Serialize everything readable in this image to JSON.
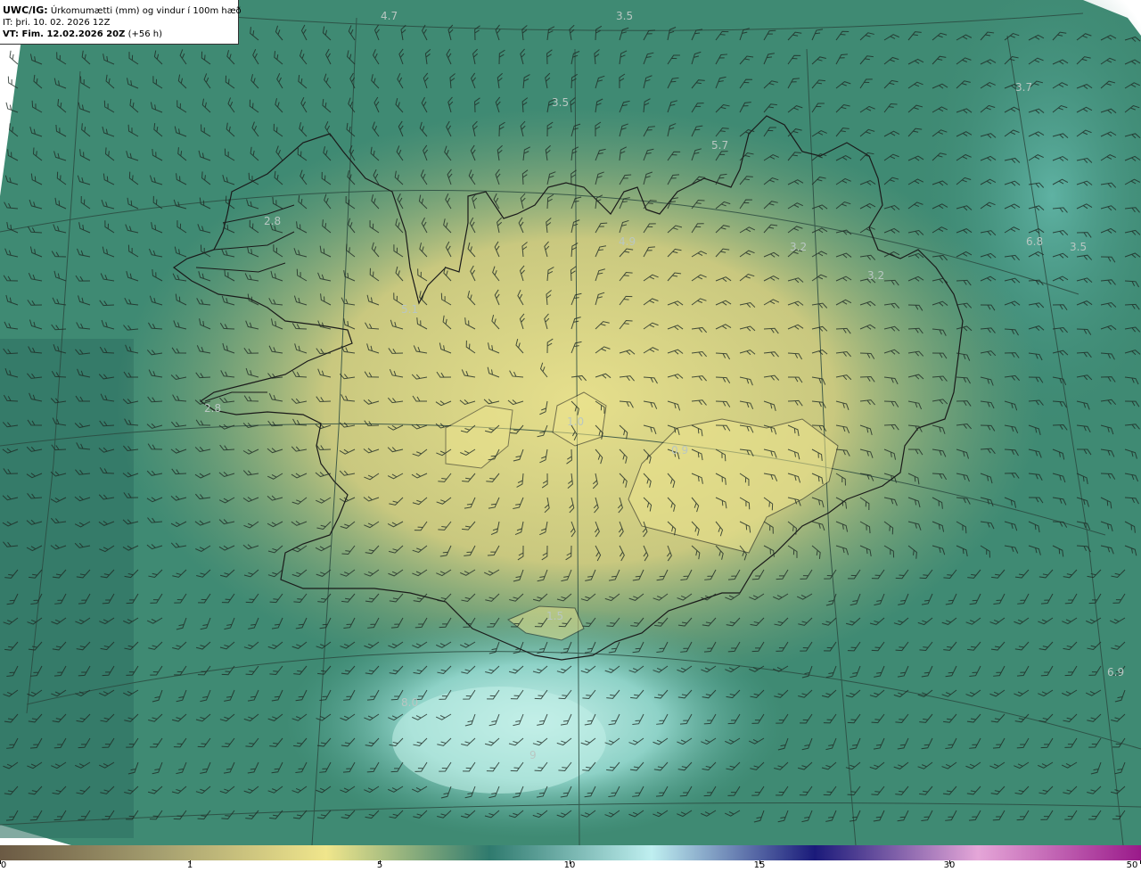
{
  "header": {
    "model_prefix": "UWC/IG:",
    "title": "Úrkomumætti (mm) og vindur í 100m hæð",
    "init_time": "IT: þri. 10. 02. 2026 12Z",
    "valid_prefix": "VT: Fim. 12.02.2026 20Z",
    "valid_offset": "(+56 h)"
  },
  "map": {
    "region": "Iceland",
    "field": "precipitable water",
    "unit": "mm",
    "value_labels": [
      "4.7",
      "3.5",
      "3.7",
      "3.5",
      "5.7",
      "2.8",
      "4.9",
      "3.2",
      "3.2",
      "6.8",
      "3.5",
      "5.1",
      "2.8",
      "1.0",
      "0.9",
      "1.5",
      "8.0",
      "9",
      "6.9"
    ]
  },
  "colorbar": {
    "ticks": [
      "0",
      "1",
      "5",
      "10",
      "15",
      "30",
      "50"
    ],
    "colors": [
      "#6b5a44",
      "#a6a070",
      "#f0e68c",
      "#2f7a6e",
      "#bfeff0",
      "#1a1a7a",
      "#e5a6d8",
      "#9a1a8a"
    ]
  }
}
